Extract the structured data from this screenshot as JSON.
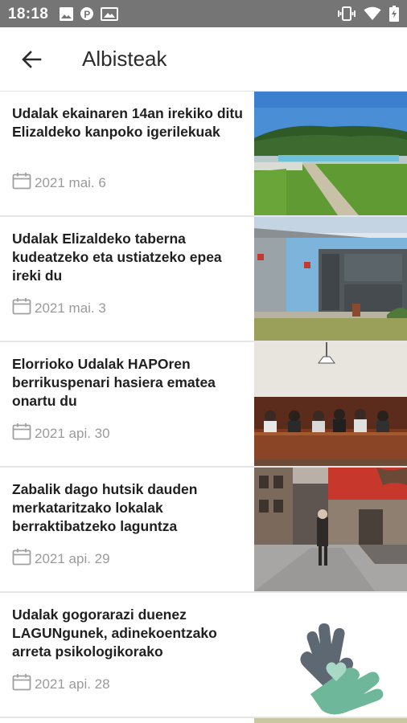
{
  "status_bar": {
    "time": "18:18",
    "left_icons": [
      "image-icon",
      "p-icon",
      "photo-icon"
    ],
    "right_icons": [
      "vibrate-icon",
      "wifi-icon",
      "battery-icon"
    ]
  },
  "app_bar": {
    "title": "Albisteak"
  },
  "news": [
    {
      "headline": "Udalak ekainaren 14an irekiko ditu Elizaldeko kanpoko igerilekuak",
      "date": "2021 mai. 6"
    },
    {
      "headline": "Udalak Elizaldeko taberna kudeatzeko eta ustiatzeko epea ireki du",
      "date": "2021 mai. 3"
    },
    {
      "headline": "Elorrioko Udalak HAPOren berrikuspenari hasiera ematea onartu du",
      "date": "2021 api. 30"
    },
    {
      "headline": "Zabalik dago hutsik dauden merkataritzako lokalak berraktibatzeko laguntza",
      "date": "2021 api. 29"
    },
    {
      "headline": "Udalak gogorarazi duenez LAGUNgunek, adinekoentzako arreta psikologikorako",
      "date": "2021 api. 28"
    }
  ]
}
